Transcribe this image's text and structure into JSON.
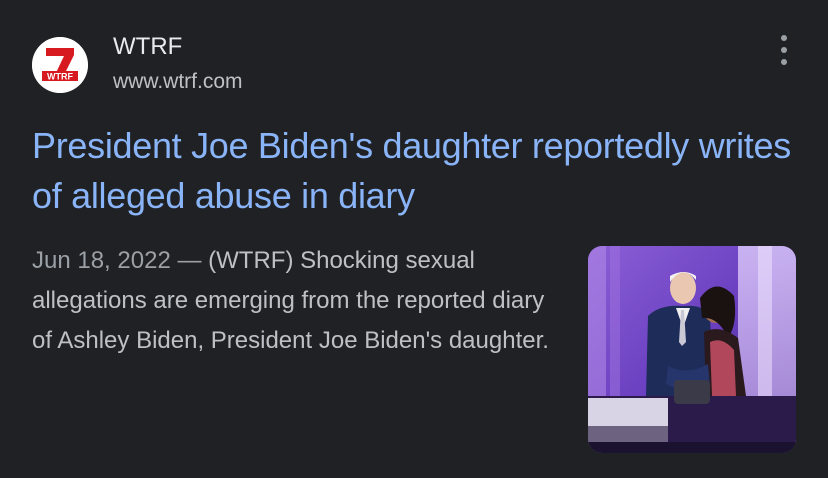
{
  "site": {
    "name": "WTRF",
    "url": "www.wtrf.com",
    "logo": {
      "number": "7",
      "text": "WTRF",
      "icon": "wtrf-7-logo",
      "red": "#d71920"
    }
  },
  "result": {
    "title": "President Joe Biden's daughter reportedly writes of alleged abuse in diary",
    "date": "Jun 18, 2022",
    "separator": " — ",
    "snippet": "(WTRF) Shocking sexual allegations are emerging from the reported diary of Ashley Biden, President Joe Biden's daughter."
  },
  "menu": {
    "icon": "more-vert-icon"
  },
  "colors": {
    "background": "#202124",
    "title_link": "#8ab4f8",
    "site_name": "#e8eaed",
    "body_text": "#bdc1c6",
    "muted": "#9aa0a6"
  }
}
